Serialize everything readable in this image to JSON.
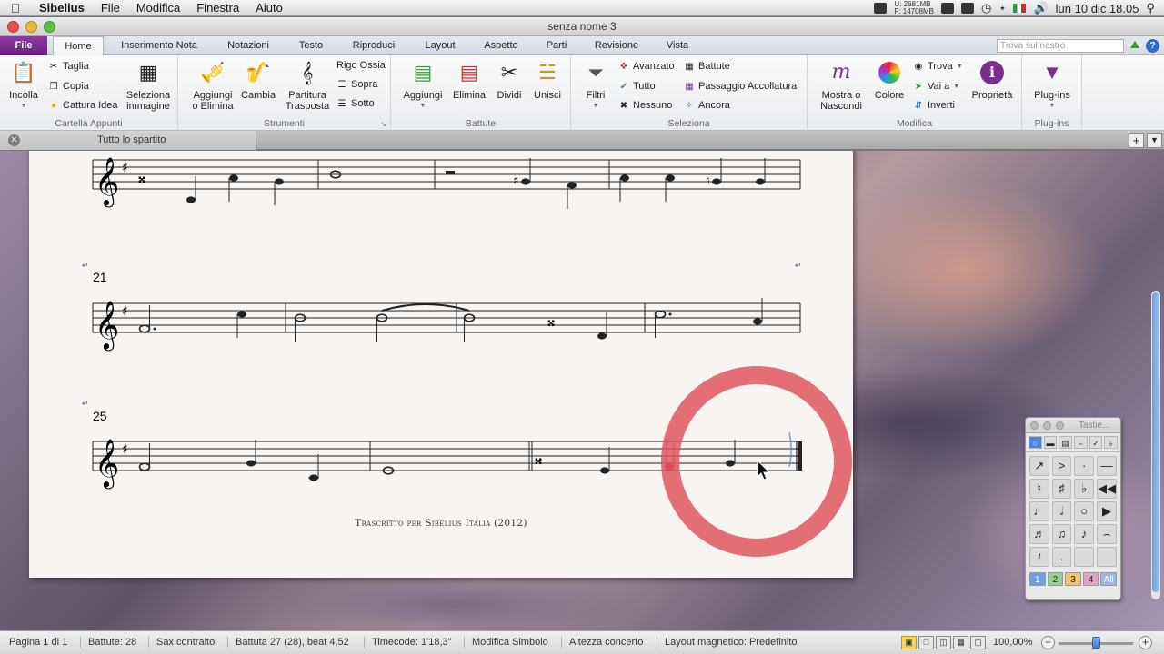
{
  "menubar": {
    "app_name": "Sibelius",
    "items": [
      "File",
      "Modifica",
      "Finestra",
      "Aiuto"
    ],
    "memory_top": "U: 2681MB",
    "memory_bottom": "F: 14708MB",
    "clock": "lun 10 dic  18.05"
  },
  "window": {
    "title": "senza nome 3"
  },
  "ribbon_tabs": {
    "file": "File",
    "tabs": [
      "Home",
      "Inserimento Nota",
      "Notazioni",
      "Testo",
      "Riproduci",
      "Layout",
      "Aspetto",
      "Parti",
      "Revisione",
      "Vista"
    ],
    "active": "Home",
    "search_placeholder": "Trova sul nastro"
  },
  "ribbon": {
    "clipboard": {
      "label": "Cartella Appunti",
      "paste": "Incolla",
      "cut": "Taglia",
      "copy": "Copia",
      "capture": "Cattura Idea",
      "select_image_1": "Seleziona",
      "select_image_2": "immagine"
    },
    "instruments": {
      "label": "Strumenti",
      "add_remove_1": "Aggiungi",
      "add_remove_2": "o Elimina",
      "change": "Cambia",
      "transpose_1": "Partitura",
      "transpose_2": "Trasposta",
      "ossia": "Rigo Ossia",
      "above": "Sopra",
      "below": "Sotto"
    },
    "bars": {
      "label": "Battute",
      "add": "Aggiungi",
      "delete": "Elimina",
      "split": "Dividi",
      "join": "Unisci"
    },
    "select": {
      "label": "Seleziona",
      "filters": "Filtri",
      "advanced": "Avanzato",
      "all": "Tutto",
      "none": "Nessuno",
      "bars": "Battute",
      "system_passage": "Passaggio Accollatura",
      "more": "Ancora"
    },
    "edit": {
      "label": "Modifica",
      "show_hide_1": "Mostra o",
      "show_hide_2": "Nascondi",
      "color": "Colore",
      "find": "Trova",
      "goto": "Vai a",
      "invert": "Inverti",
      "properties": "Proprietà"
    },
    "plugins": {
      "label": "Plug-ins",
      "button": "Plug-ins"
    }
  },
  "doc_tab": {
    "label": "Tutto lo spartito"
  },
  "score": {
    "system2_number": "21",
    "system3_number": "25",
    "credit": "Trascritto per Sibelius Italia (2012)"
  },
  "keypad": {
    "title": "Tastie...",
    "layouts": [
      "1",
      "2",
      "3",
      "4",
      "All"
    ]
  },
  "statusbar": {
    "page": "Pagina 1 di 1",
    "bars": "Battute: 28",
    "instrument": "Sax contralto",
    "position": "Battuta 27 (28), beat 4,52",
    "timecode": "Timecode: 1'18,3\"",
    "mode": "Modifica Simbolo",
    "pitch": "Altezza concerto",
    "layout": "Layout magnetico: Predefinito",
    "zoom": "100,00%"
  },
  "colors": {
    "file_tab": "#7a2e90",
    "highlight_ring": "#de505a",
    "selected_note": "#e0242e",
    "keypad_active": "#4a86d8"
  }
}
